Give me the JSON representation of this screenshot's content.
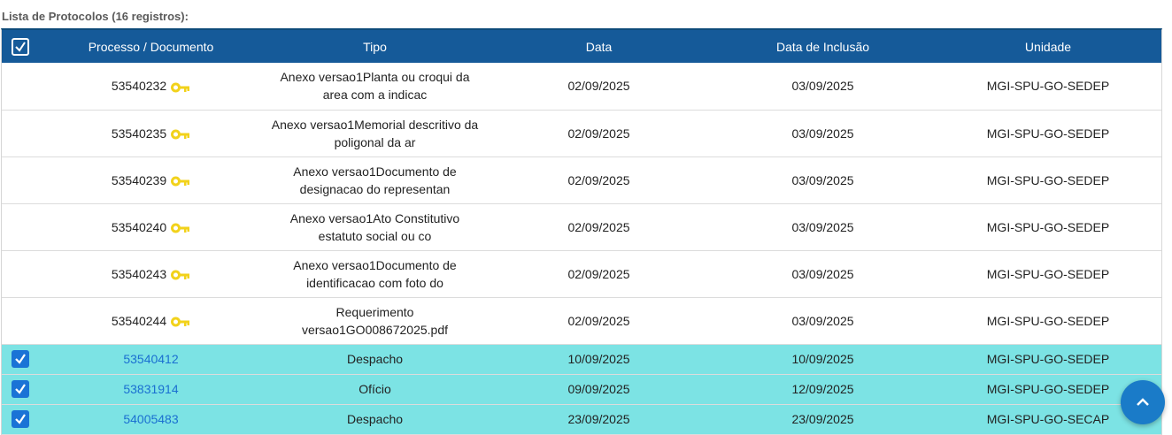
{
  "caption": "Lista de Protocolos (16 registros):",
  "columns": [
    "Processo / Documento",
    "Tipo",
    "Data",
    "Data de Inclusão",
    "Unidade"
  ],
  "rows": [
    {
      "processo": "53540232",
      "tipo": "Anexo versao1Planta ou croqui da area com a indicac",
      "data": "02/09/2025",
      "inclusao": "03/09/2025",
      "unidade": "MGI-SPU-GO-SEDEP"
    },
    {
      "processo": "53540235",
      "tipo": "Anexo versao1Memorial descritivo da poligonal da ar",
      "data": "02/09/2025",
      "inclusao": "03/09/2025",
      "unidade": "MGI-SPU-GO-SEDEP"
    },
    {
      "processo": "53540239",
      "tipo": "Anexo versao1Documento de designacao do representan",
      "data": "02/09/2025",
      "inclusao": "03/09/2025",
      "unidade": "MGI-SPU-GO-SEDEP"
    },
    {
      "processo": "53540240",
      "tipo": "Anexo versao1Ato Constitutivo estatuto social ou co",
      "data": "02/09/2025",
      "inclusao": "03/09/2025",
      "unidade": "MGI-SPU-GO-SEDEP"
    },
    {
      "processo": "53540243",
      "tipo": "Anexo versao1Documento de identificacao com foto do",
      "data": "02/09/2025",
      "inclusao": "03/09/2025",
      "unidade": "MGI-SPU-GO-SEDEP"
    },
    {
      "processo": "53540244",
      "tipo": "Requerimento versao1GO008672025.pdf",
      "data": "02/09/2025",
      "inclusao": "03/09/2025",
      "unidade": "MGI-SPU-GO-SEDEP"
    },
    {
      "processo": "53540412",
      "tipo": "Despacho",
      "data": "10/09/2025",
      "inclusao": "10/09/2025",
      "unidade": "MGI-SPU-GO-SEDEP"
    },
    {
      "processo": "53831914",
      "tipo": "Ofício",
      "data": "09/09/2025",
      "inclusao": "12/09/2025",
      "unidade": "MGI-SPU-GO-SEDEP"
    },
    {
      "processo": "54005483",
      "tipo": "Despacho",
      "data": "23/09/2025",
      "inclusao": "23/09/2025",
      "unidade": "MGI-SPU-GO-SECAP"
    }
  ],
  "colors": {
    "header": "#155a99",
    "selected_row": "#7ce3e4",
    "link": "#1a6fd1",
    "key": "#f2d21b",
    "checkbox": "#1a73d6"
  },
  "icons": {
    "key": "key-icon",
    "checked": "checkbox-checked-icon",
    "scroll_top": "chevron-up-icon"
  }
}
